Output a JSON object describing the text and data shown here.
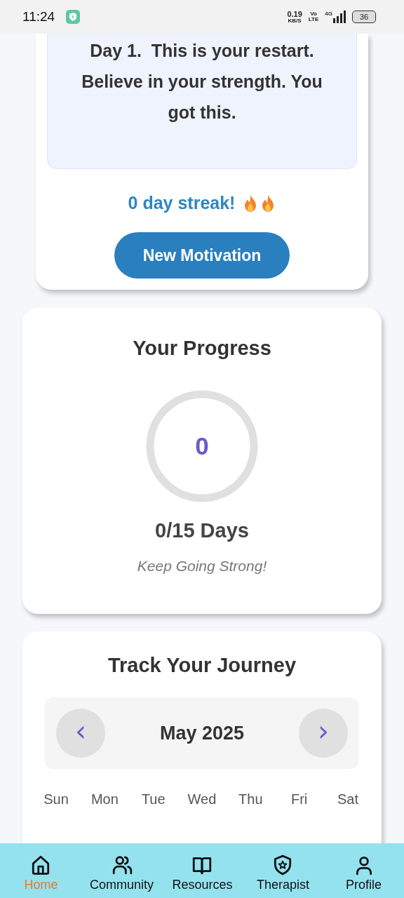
{
  "status_bar": {
    "time": "11:24",
    "speed": "0.19",
    "speed_unit": "KB/S",
    "volte_top": "Vo",
    "volte_bottom": "LTE",
    "network": "4G",
    "battery": "36"
  },
  "motivation": {
    "quote": "Day 1.  This is your restart. Believe in your strength. You got this.",
    "streak": "0 day streak!",
    "streak_icons": [
      {
        "kind": "fire"
      },
      {
        "kind": "fire"
      }
    ],
    "button": "New Motivation"
  },
  "progress": {
    "title": "Your Progress",
    "count": "0",
    "level": 0,
    "days": "0/15 Days",
    "caption": "Keep Going Strong!"
  },
  "journey": {
    "title": "Track Your Journey",
    "month": "May 2025",
    "prev": "‹",
    "next": "›",
    "weekdays": [
      "Sun",
      "Mon",
      "Tue",
      "Wed",
      "Thu",
      "Fri",
      "Sat"
    ]
  },
  "nav": [
    {
      "label": "Home",
      "kind": "home",
      "selected": true
    },
    {
      "label": "Community",
      "kind": "people",
      "selected": false
    },
    {
      "label": "Resources",
      "kind": "book",
      "selected": false
    },
    {
      "label": "Therapist",
      "kind": "shield",
      "selected": false
    },
    {
      "label": "Profile",
      "kind": "person",
      "selected": false
    }
  ]
}
